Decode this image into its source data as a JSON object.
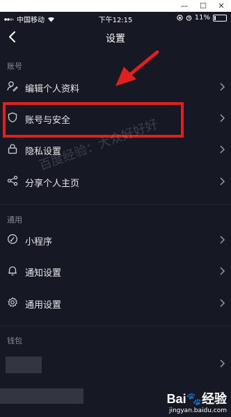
{
  "window": {
    "min_glyph": "—",
    "max_glyph": "☐",
    "close_glyph": "✕"
  },
  "status": {
    "carrier": "中国移动",
    "time": "下午12:15",
    "battery": "11%",
    "battery_fraction": 0.11
  },
  "header": {
    "title": "设置"
  },
  "sections": [
    {
      "label": "账号",
      "items": [
        {
          "label": "编辑个人资料",
          "icon": "edit-profile-icon"
        },
        {
          "label": "账号与安全",
          "icon": "shield-icon"
        },
        {
          "label": "隐私设置",
          "icon": "lock-icon"
        },
        {
          "label": "分享个人主页",
          "icon": "share-icon"
        }
      ]
    },
    {
      "label": "通用",
      "items": [
        {
          "label": "小程序",
          "icon": "link-icon"
        },
        {
          "label": "通知设置",
          "icon": "bell-icon"
        },
        {
          "label": "通用设置",
          "icon": "gear-icon"
        }
      ]
    },
    {
      "label": "钱包",
      "items": []
    }
  ],
  "watermark": "百度经验：大众好好好",
  "baidu": {
    "brand": "Bai🐾经验",
    "site": "jingyan.baidu.com"
  },
  "colors": {
    "background": "#161823",
    "annotation": "#e0201f",
    "text": "#e8e8ea",
    "muted": "#8a8b91"
  }
}
